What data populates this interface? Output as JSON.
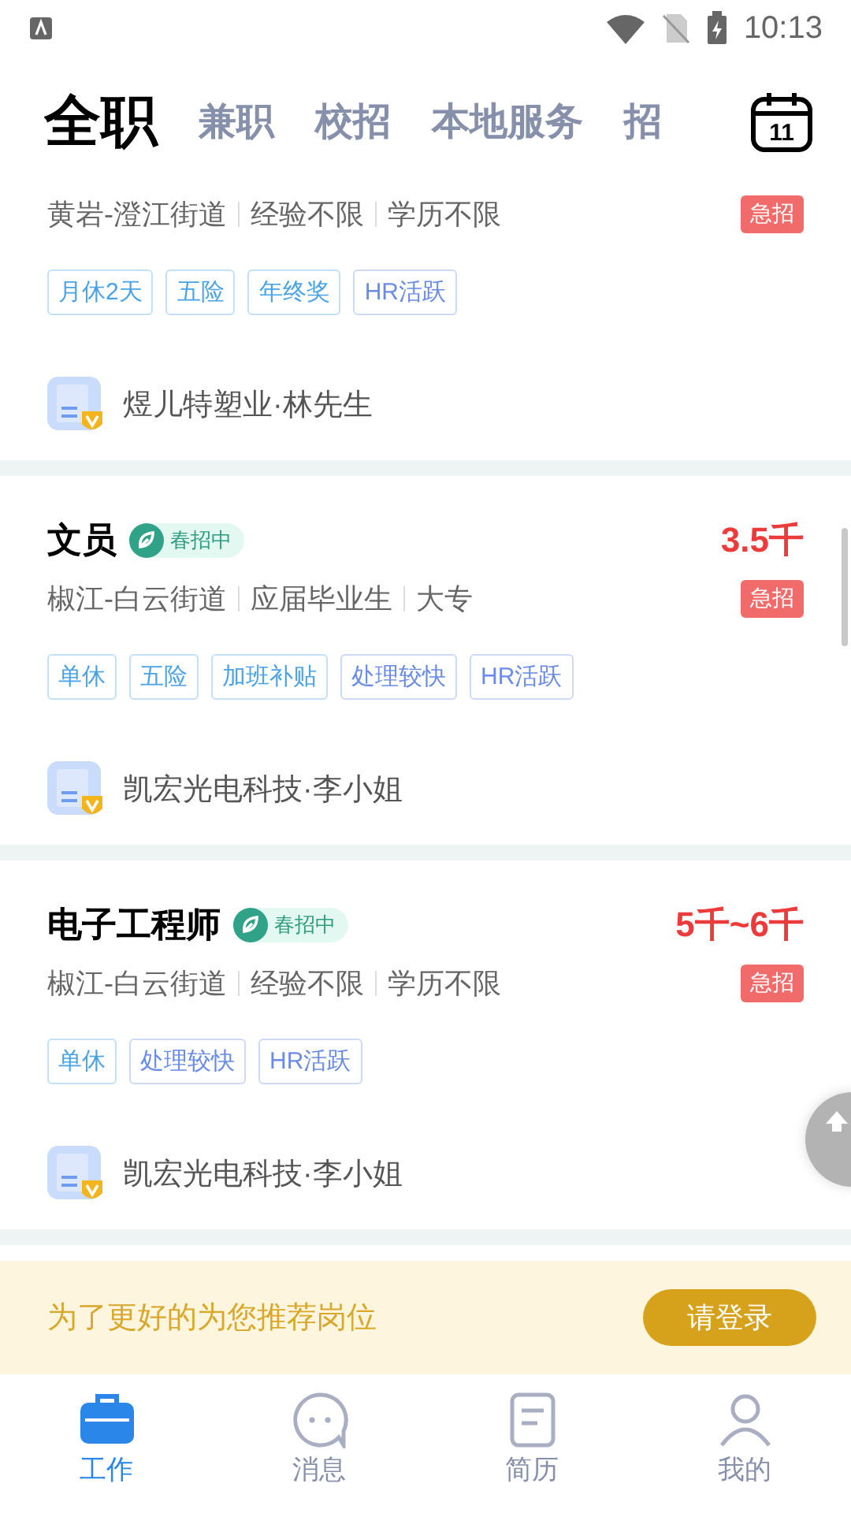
{
  "status_bar": {
    "time": "10:13"
  },
  "tabs": [
    {
      "label": "全职",
      "selected": true
    },
    {
      "label": "兼职",
      "selected": false
    },
    {
      "label": "校招",
      "selected": false
    },
    {
      "label": "本地服务",
      "selected": false
    },
    {
      "label": "招",
      "selected": false
    }
  ],
  "calendar": {
    "day": "11"
  },
  "jobs": [
    {
      "location": [
        "黄岩-澄江街道",
        "经验不限",
        "学历不限"
      ],
      "urgent": "急招",
      "tags": [
        {
          "text": "月休2天",
          "color": "#4aa3e6"
        },
        {
          "text": "五险",
          "color": "#4aa3e6"
        },
        {
          "text": "年终奖",
          "color": "#4aa3e6"
        },
        {
          "text": "HR活跃",
          "color": "#6a8ce6"
        }
      ],
      "company": "煜儿特塑业·林先生"
    },
    {
      "title": "文员",
      "badge": "春招中",
      "salary": "3.5千",
      "location": [
        "椒江-白云街道",
        "应届毕业生",
        "大专"
      ],
      "urgent": "急招",
      "tags": [
        {
          "text": "单休",
          "color": "#4aa3e6"
        },
        {
          "text": "五险",
          "color": "#4aa3e6"
        },
        {
          "text": "加班补贴",
          "color": "#4aa3e6"
        },
        {
          "text": "处理较快",
          "color": "#6a8ce6"
        },
        {
          "text": "HR活跃",
          "color": "#6a8ce6"
        }
      ],
      "company": "凯宏光电科技·李小姐"
    },
    {
      "title": "电子工程师",
      "badge": "春招中",
      "salary": "5千~6千",
      "location": [
        "椒江-白云街道",
        "经验不限",
        "学历不限"
      ],
      "urgent": "急招",
      "tags": [
        {
          "text": "单休",
          "color": "#4aa3e6"
        },
        {
          "text": "处理较快",
          "color": "#6a8ce6"
        },
        {
          "text": "HR活跃",
          "color": "#6a8ce6"
        }
      ],
      "company": "凯宏光电科技·李小姐"
    }
  ],
  "login_banner": {
    "text": "为了更好的为您推荐岗位",
    "button": "请登录"
  },
  "bottom_nav": [
    {
      "label": "工作",
      "selected": true,
      "kind": "work"
    },
    {
      "label": "消息",
      "selected": false,
      "kind": "message"
    },
    {
      "label": "简历",
      "selected": false,
      "kind": "resume"
    },
    {
      "label": "我的",
      "selected": false,
      "kind": "profile"
    }
  ]
}
